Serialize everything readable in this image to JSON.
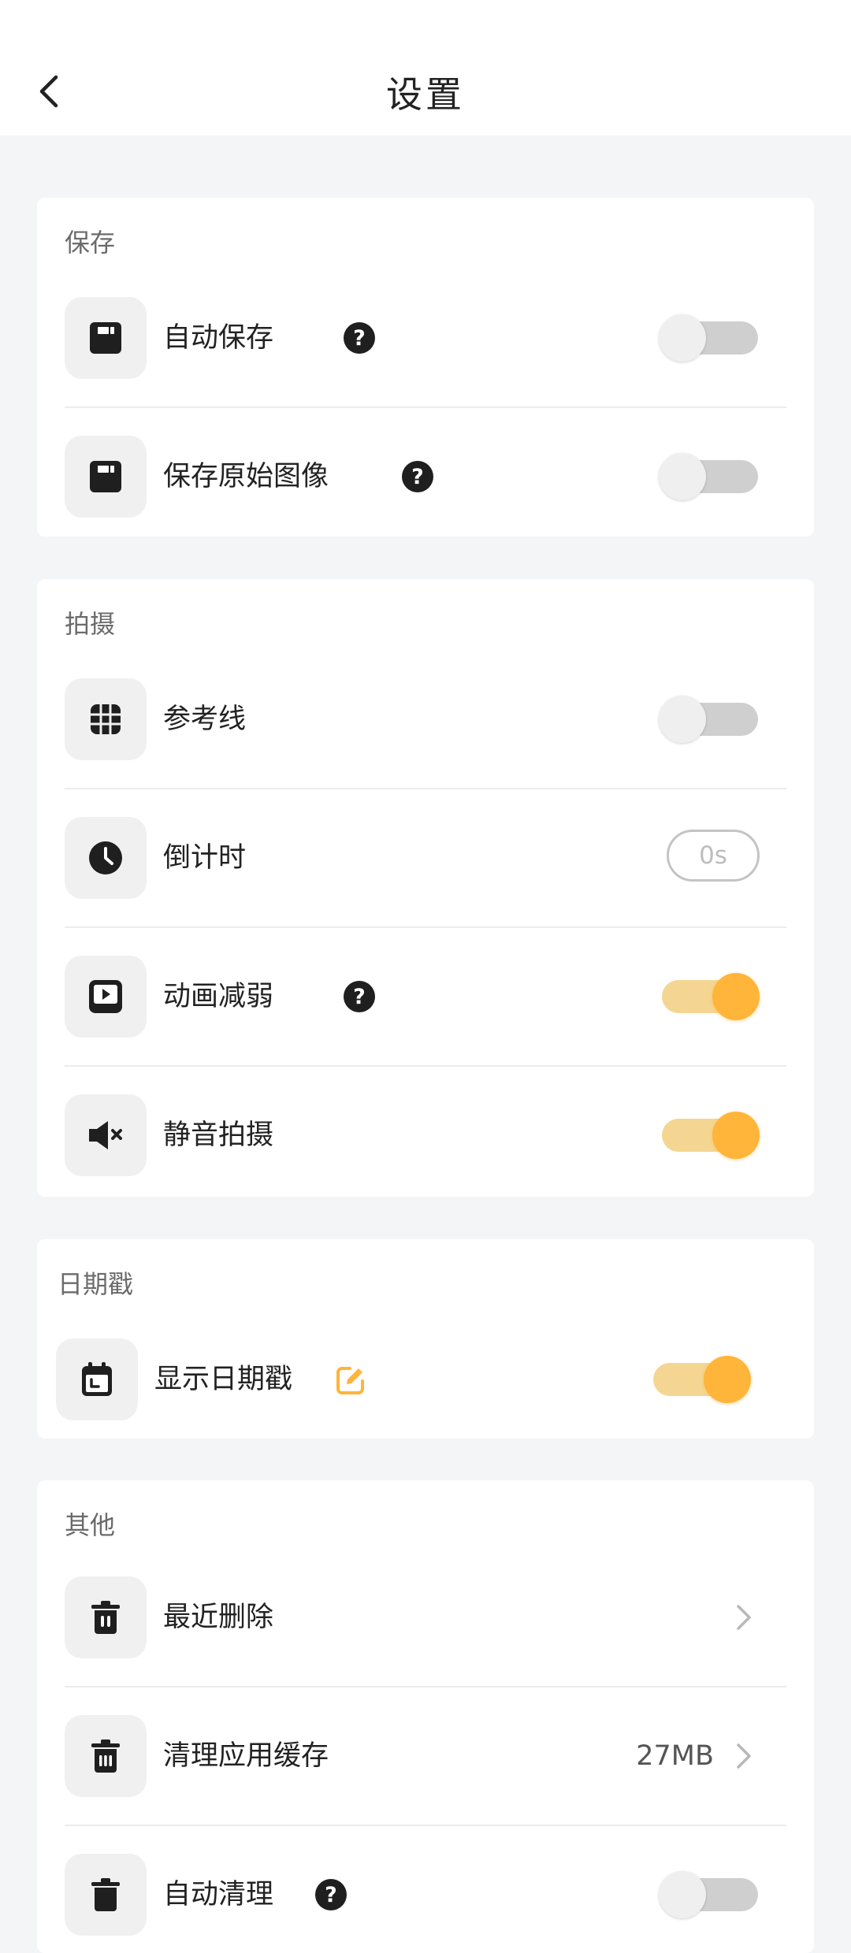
{
  "header": {
    "title": "设置"
  },
  "sections": {
    "save": {
      "title": "保存",
      "items": [
        {
          "label": "自动保存",
          "toggle": "off"
        },
        {
          "label": "保存原始图像",
          "toggle": "off"
        }
      ]
    },
    "shoot": {
      "title": "拍摄",
      "items": [
        {
          "label": "参考线",
          "toggle": "off"
        },
        {
          "label": "倒计时",
          "value": "0s"
        },
        {
          "label": "动画减弱",
          "toggle": "on"
        },
        {
          "label": "静音拍摄",
          "toggle": "on"
        }
      ]
    },
    "date": {
      "title": "日期戳",
      "items": [
        {
          "label": "显示日期戳",
          "toggle": "on"
        }
      ]
    },
    "other": {
      "title": "其他",
      "items": [
        {
          "label": "最近删除"
        },
        {
          "label": "清理应用缓存",
          "value": "27MB"
        },
        {
          "label": "自动清理",
          "toggle": "off"
        }
      ]
    }
  },
  "help_symbol": "?",
  "colors": {
    "accent": "#ffb43a",
    "accent_track": "#f4d692",
    "off_track": "#cfcfcf",
    "background": "#f4f5f7"
  }
}
